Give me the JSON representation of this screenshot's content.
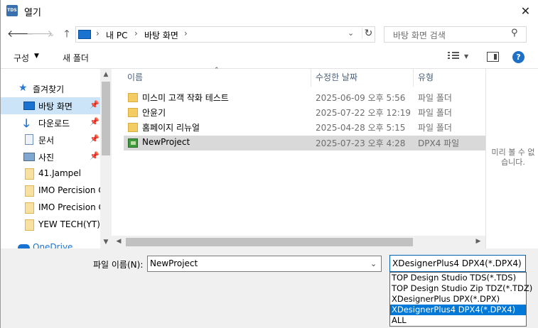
{
  "window": {
    "app_icon": "TDS",
    "title": "열기",
    "close": "✕"
  },
  "nav": {
    "back": "🡐",
    "forward": "🡒",
    "recent": "⌄",
    "up": "🡑",
    "address_segments": [
      "내 PC",
      "바탕 화면"
    ],
    "chev": "›",
    "search_placeholder": "바탕 화면 검색"
  },
  "toolbar": {
    "organize": "구성",
    "new_folder": "새 폴더",
    "help": "?"
  },
  "sidebar": {
    "items": [
      {
        "label": "즐겨찾기"
      },
      {
        "label": "바탕 화면"
      },
      {
        "label": "다운로드"
      },
      {
        "label": "문서"
      },
      {
        "label": "사진"
      },
      {
        "label": "41.Jampel"
      },
      {
        "label": "IMO Percision C"
      },
      {
        "label": "IMO Precision C"
      },
      {
        "label": "YEW TECH(YT)"
      },
      {
        "label": "OneDrive"
      }
    ]
  },
  "columns": {
    "name": "이름",
    "date": "수정한 날짜",
    "type": "유형"
  },
  "files": [
    {
      "name": "미스미 고객 작화 테스트",
      "date": "2025-06-09 오후 5:56",
      "type": "파일 폴더"
    },
    {
      "name": "안윤기",
      "date": "2025-07-22 오후 12:19",
      "type": "파일 폴더"
    },
    {
      "name": "홈페이지 리뉴얼",
      "date": "2025-04-28 오후 5:15",
      "type": "파일 폴더"
    },
    {
      "name": "NewProject",
      "date": "2025-07-23 오후 4:28",
      "type": "DPX4 파일"
    }
  ],
  "preview": {
    "text": "미리 볼 수 없습니다."
  },
  "bottom": {
    "filename_label": "파일 이름(N):",
    "filename_value": "NewProject",
    "filetype_selected": "XDesignerPlus4 DPX4(*.DPX4)",
    "filetype_options": [
      "TOP Design Studio TDS(*.TDS)",
      "TOP Design Studio Zip TDZ(*.TDZ)",
      "XDesignerPlus DPX(*.DPX)",
      "XDesignerPlus4 DPX4(*.DPX4)",
      "ALL"
    ]
  },
  "colors": {
    "accent": "#0078d7",
    "selected_nav": "#cce4f7",
    "selected_row": "#d9d9d9",
    "folder": "#f3cd63"
  }
}
